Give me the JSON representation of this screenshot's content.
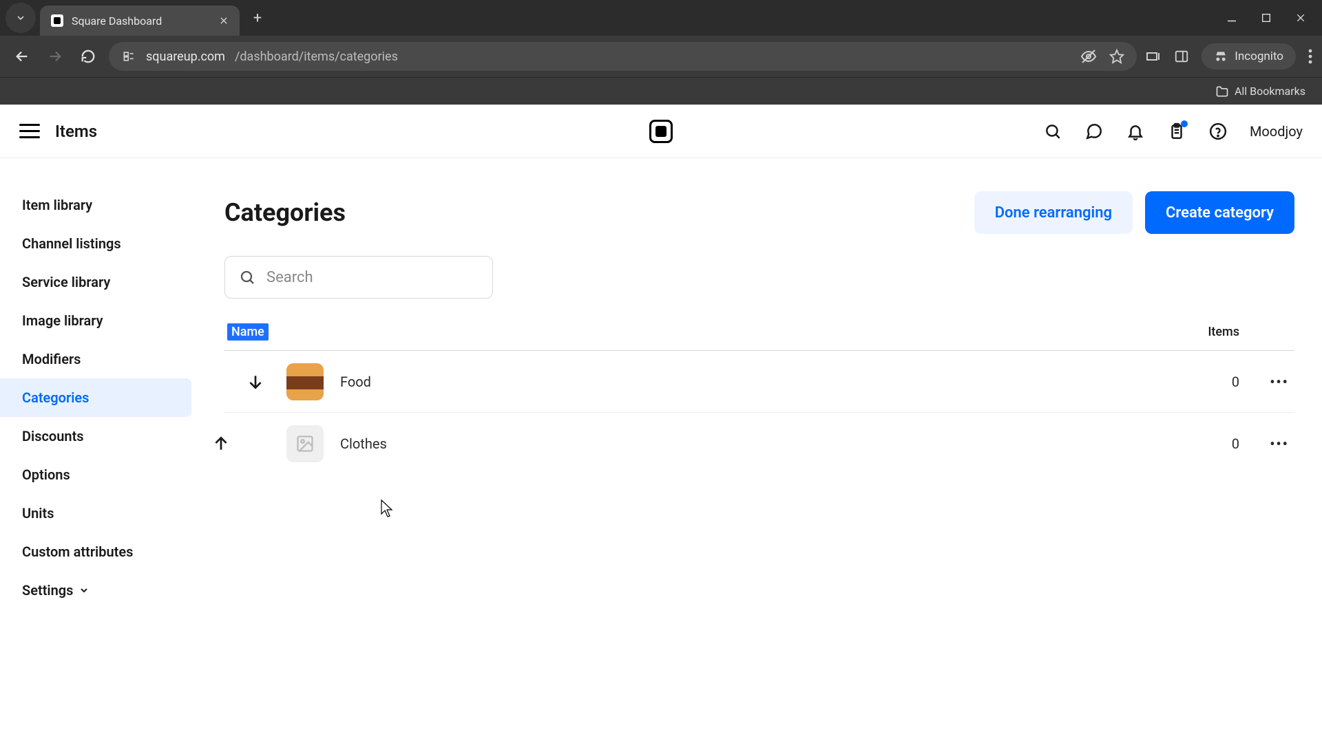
{
  "browser": {
    "tab_title": "Square Dashboard",
    "url_host": "squareup.com",
    "url_path": "/dashboard/items/categories",
    "incognito_label": "Incognito",
    "bookmarks_label": "All Bookmarks"
  },
  "header": {
    "section": "Items",
    "user": "Moodjoy"
  },
  "sidebar": {
    "items": [
      {
        "label": "Item library",
        "active": false
      },
      {
        "label": "Channel listings",
        "active": false
      },
      {
        "label": "Service library",
        "active": false
      },
      {
        "label": "Image library",
        "active": false
      },
      {
        "label": "Modifiers",
        "active": false
      },
      {
        "label": "Categories",
        "active": true
      },
      {
        "label": "Discounts",
        "active": false
      },
      {
        "label": "Options",
        "active": false
      },
      {
        "label": "Units",
        "active": false
      },
      {
        "label": "Custom attributes",
        "active": false
      },
      {
        "label": "Settings",
        "active": false,
        "has_chevron": true
      }
    ]
  },
  "main": {
    "title": "Categories",
    "done_label": "Done rearranging",
    "create_label": "Create category",
    "search_placeholder": "Search",
    "columns": {
      "name": "Name",
      "items": "Items"
    },
    "rows": [
      {
        "name": "Food",
        "count": "0",
        "thumb": "food",
        "reorder": "down"
      },
      {
        "name": "Clothes",
        "count": "0",
        "thumb": "placeholder",
        "reorder": "up"
      }
    ]
  }
}
